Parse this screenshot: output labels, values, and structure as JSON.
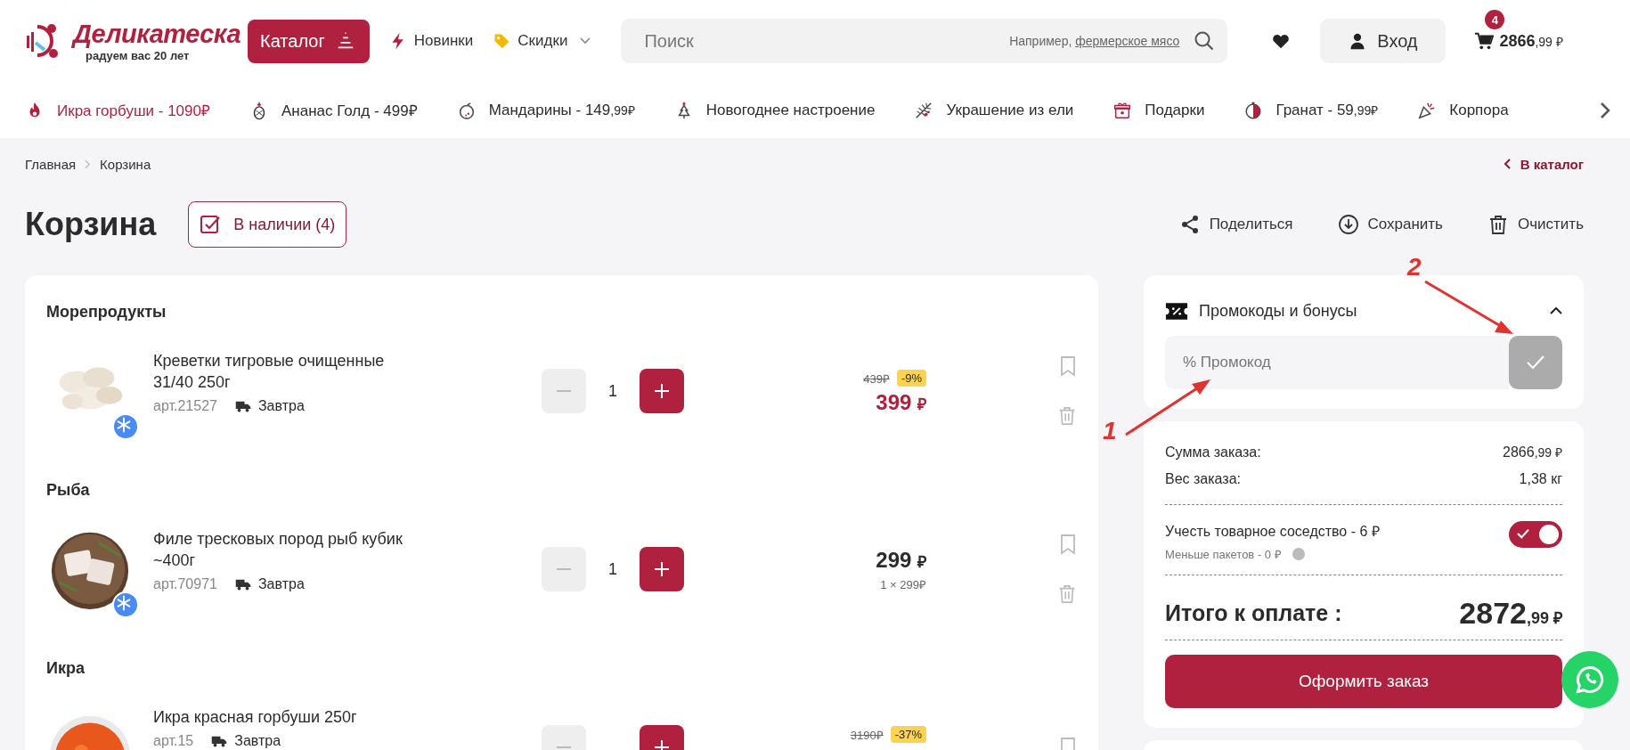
{
  "header": {
    "logo": {
      "name": "Деликатеска",
      "tagline": "радуем вас 20 лет"
    },
    "catalog_button": "Каталог",
    "nav": [
      {
        "label": "Новинки",
        "kind": "new"
      },
      {
        "label": "Скидки",
        "kind": "sale"
      }
    ],
    "search": {
      "placeholder": "Поиск",
      "hint": "Например,",
      "hint_link": "фермерское мясо"
    },
    "login": "Вход",
    "cart": {
      "count": "4",
      "total": "2866",
      "total_small": ",99 ₽"
    }
  },
  "strip": [
    {
      "text": "Икра горбуши - 1090₽",
      "highlight": true
    },
    {
      "text": "Ананас Голд - 499₽",
      "highlight": false
    },
    {
      "text": "Мандарины - 149",
      "small": ",99₽",
      "highlight": false
    },
    {
      "text": "Новогоднее настроение",
      "highlight": false
    },
    {
      "text": "Украшение из ели",
      "highlight": false
    },
    {
      "text": "Подарки",
      "highlight": false
    },
    {
      "text": "Гранат - 59",
      "small": ",99₽",
      "highlight": false
    },
    {
      "text": "Корпора",
      "highlight": false
    }
  ],
  "breadcrumbs": [
    "Главная",
    "Корзина"
  ],
  "back_link": "В каталог",
  "title": "Корзина",
  "filter": {
    "label": "В наличии (4)",
    "checked": true
  },
  "actions": [
    {
      "label": "Поделиться"
    },
    {
      "label": "Сохранить"
    },
    {
      "label": "Очистить"
    }
  ],
  "groups": [
    {
      "title": "Морепродукты",
      "items": [
        {
          "name": "Креветки тигровые очищенные 31/40 250г",
          "art": "арт.21527",
          "delivery": "Завтра",
          "qty": "1",
          "old_price": "439₽",
          "discount": "-9%",
          "price": "399",
          "currency": "₽",
          "frozen": true
        }
      ]
    },
    {
      "title": "Рыба",
      "items": [
        {
          "name": "Филе тресковых пород рыб кубик ~400г",
          "art": "арт.70971",
          "delivery": "Завтра",
          "qty": "1",
          "price": "299",
          "currency": "₽",
          "unit_price": "1 × 299₽",
          "frozen": true
        }
      ]
    },
    {
      "title": "Икра",
      "items": [
        {
          "name": "Икра красная горбуши 250г",
          "art": "арт.15",
          "delivery": "Завтра",
          "old_price": "3190₽",
          "discount": "-37%",
          "frozen": false
        }
      ]
    }
  ],
  "promo": {
    "title": "Промокоды и бонусы",
    "expanded": true,
    "placeholder": "% Промокод",
    "apply_disabled": true
  },
  "summary": {
    "rows": [
      {
        "label": "Сумма заказа:",
        "value": "2866",
        "small": ",99 ₽"
      },
      {
        "label": "Вес заказа:",
        "value": "1,38 кг"
      }
    ],
    "option": {
      "label": "Учесть товарное соседство - 6 ₽",
      "note": "Меньше пакетов - 0 ₽",
      "on": true
    },
    "total": {
      "label": "Итого к оплате :",
      "value": "2872",
      "small": ",99 ₽"
    },
    "checkout": "Оформить заказ"
  },
  "annotations": [
    {
      "label": "1"
    },
    {
      "label": "2"
    }
  ]
}
